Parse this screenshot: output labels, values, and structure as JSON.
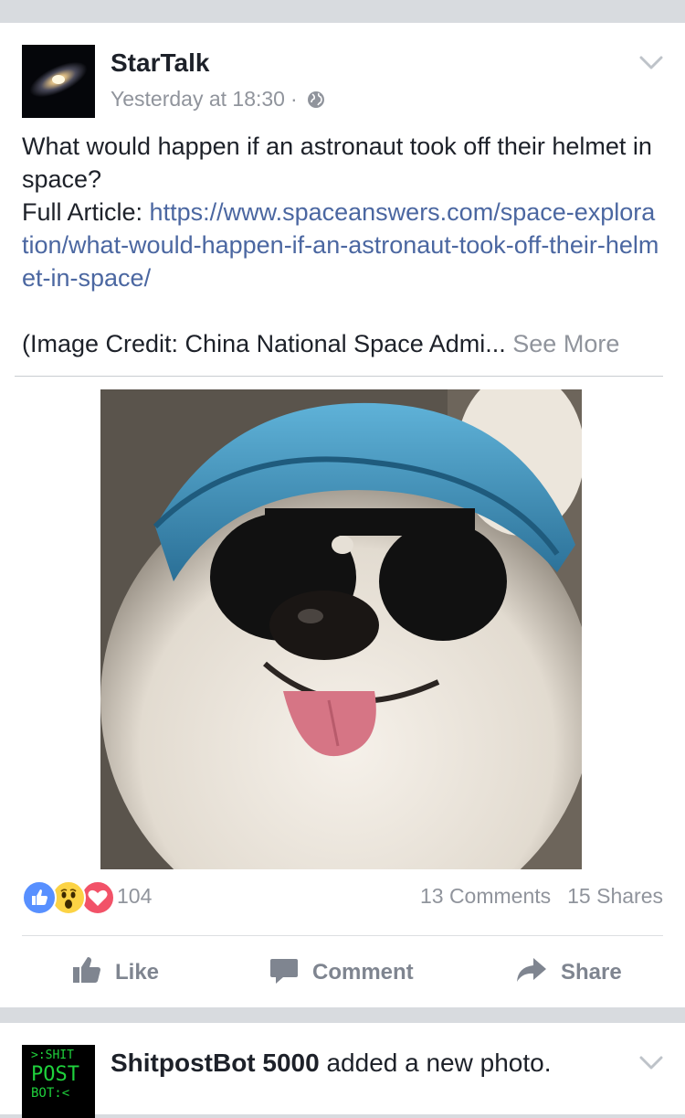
{
  "post1": {
    "author": "StarTalk",
    "timestamp": "Yesterday at 18:30",
    "separator": "·",
    "privacy_icon": "globe-icon",
    "text_line": "What would happen if an astronaut took off their helmet in space?",
    "article_label": "Full Article: ",
    "article_url": "https://www.spaceanswers.com/space-exploration/what-would-happen-if-an-astronaut-took-off-their-helmet-in-space/",
    "credit_text": "(Image Credit: China National Space Admi...",
    "see_more": "See More",
    "photo_description_icon": "dog-with-cap-and-sunglasses-photo",
    "reactions": {
      "icons": [
        "like-reaction-icon",
        "wow-reaction-icon",
        "love-reaction-icon"
      ],
      "count": "104"
    },
    "comments": "13 Comments",
    "shares": "15 Shares",
    "actions": {
      "like": "Like",
      "comment": "Comment",
      "share": "Share"
    }
  },
  "post2": {
    "author": "ShitpostBot 5000",
    "action_text": " added a new photo.",
    "avatar_lines": [
      ">:SHIT",
      "POST",
      "BOT:<"
    ]
  },
  "colors": {
    "link": "#4b67a1",
    "secondary_text": "#90949c",
    "action_text": "#7f8590",
    "like_blue": "#5890ff",
    "love_red": "#f25268",
    "wow_yellow": "#fcd345"
  }
}
